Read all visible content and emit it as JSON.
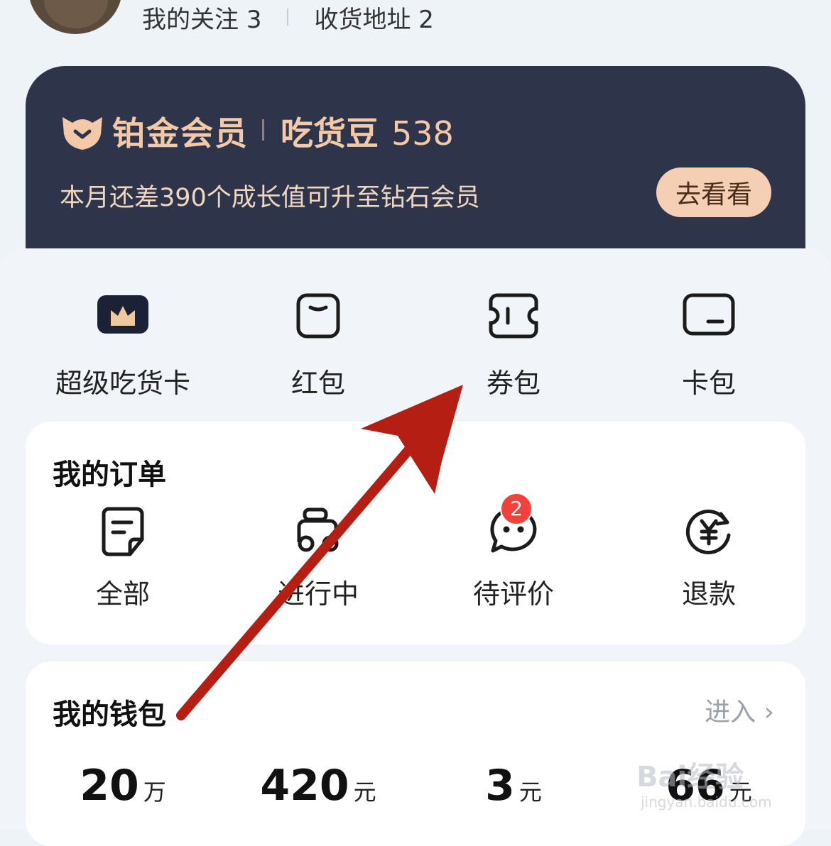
{
  "profile": {
    "following_label": "我的关注",
    "following_count": "3",
    "address_label": "收货地址",
    "address_count": "2"
  },
  "membership": {
    "tier": "铂金会员",
    "beans_label": "吃货豆",
    "beans_count": "538",
    "tip": "本月还差390个成长值可升至钻石会员",
    "cta": "去看看"
  },
  "quick_actions": [
    {
      "label": "超级吃货卡",
      "icon": "crown-card-icon"
    },
    {
      "label": "红包",
      "icon": "red-packet-icon"
    },
    {
      "label": "券包",
      "icon": "coupon-icon"
    },
    {
      "label": "卡包",
      "icon": "card-wallet-icon"
    }
  ],
  "orders": {
    "title": "我的订单",
    "items": [
      {
        "label": "全部",
        "icon": "order-list-icon"
      },
      {
        "label": "进行中",
        "icon": "scooter-icon"
      },
      {
        "label": "待评价",
        "icon": "chat-bubble-icon",
        "badge": "2"
      },
      {
        "label": "退款",
        "icon": "refund-yen-icon"
      }
    ]
  },
  "wallet": {
    "title": "我的钱包",
    "enter": "进入",
    "values": [
      {
        "num": "20",
        "unit": "万"
      },
      {
        "num": "420",
        "unit": "元"
      },
      {
        "num": "3",
        "unit": "元"
      },
      {
        "num": "66",
        "unit": "元"
      }
    ]
  },
  "watermark": {
    "line1": "Bai经验",
    "line2": "jingyan.baidu.com"
  },
  "colors": {
    "member_bg": "#2e354a",
    "gold": "#f3c9a7",
    "badge": "#f2403b",
    "arrow": "#b51e12"
  }
}
